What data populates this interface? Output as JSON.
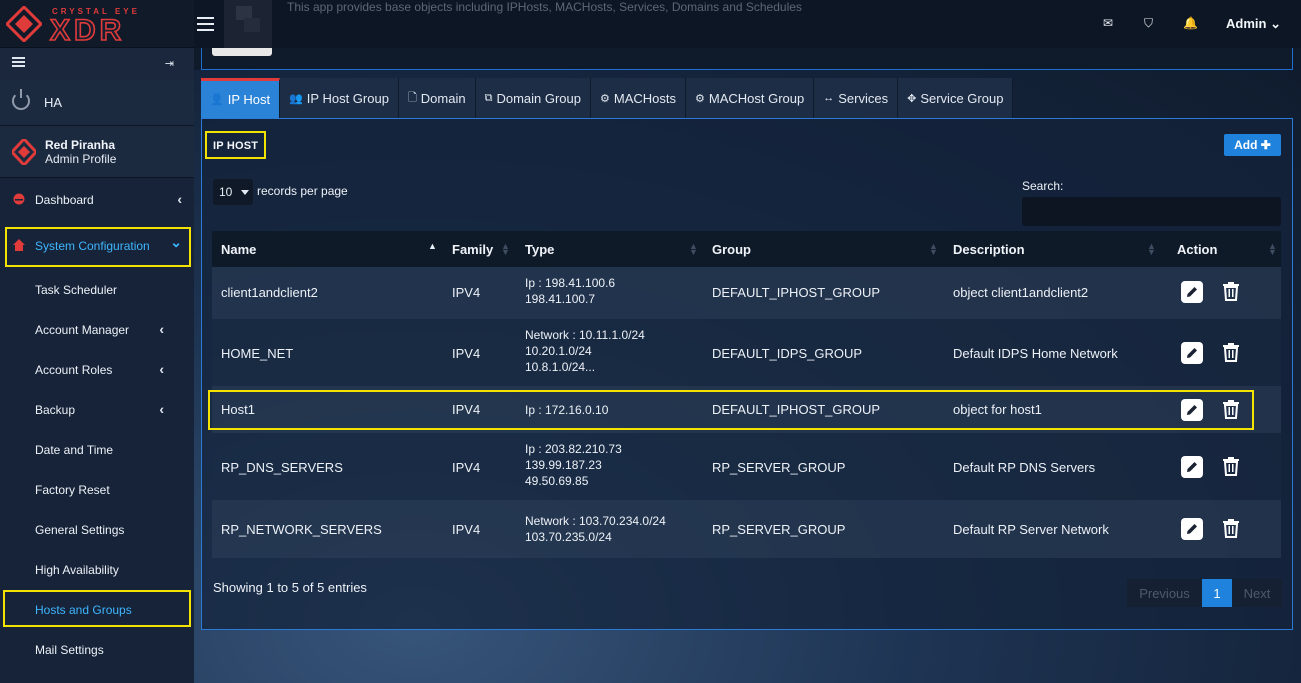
{
  "logo": {
    "top_text": "CRYSTAL EYE",
    "main_text": "XDR"
  },
  "topbar": {
    "app_description": "This app provides base objects including IPHosts, MACHosts, Services, Domains and Schedules",
    "icons": [
      "envelope-icon",
      "shield-icon",
      "bell-icon"
    ],
    "admin_label": "Admin"
  },
  "sidebar": {
    "ha_label": "HA",
    "profile_name": "Red Piranha",
    "profile_sub": "Admin Profile",
    "items": [
      {
        "label": "Dashboard"
      },
      {
        "label": "System Configuration"
      },
      {
        "label": "Task Scheduler"
      },
      {
        "label": "Account Manager"
      },
      {
        "label": "Account Roles"
      },
      {
        "label": "Backup"
      },
      {
        "label": "Date and Time"
      },
      {
        "label": "Factory Reset"
      },
      {
        "label": "General Settings"
      },
      {
        "label": "High Availability"
      },
      {
        "label": "Hosts and Groups"
      },
      {
        "label": "Mail Settings"
      }
    ]
  },
  "tabs": [
    {
      "label": "IP Host",
      "icon": "user-icon",
      "active": true
    },
    {
      "label": "IP Host Group",
      "icon": "users-icon"
    },
    {
      "label": "Domain",
      "icon": "file-icon"
    },
    {
      "label": "Domain Group",
      "icon": "files-icon"
    },
    {
      "label": "MACHosts",
      "icon": "gear-icon"
    },
    {
      "label": "MACHost Group",
      "icon": "gears-icon"
    },
    {
      "label": "Services",
      "icon": "arrows-horizontal-icon"
    },
    {
      "label": "Service Group",
      "icon": "arrows-cross-icon"
    }
  ],
  "panel": {
    "title": "IP HOST",
    "add_label": "Add",
    "page_length": "10",
    "length_label": "records per page",
    "search_label": "Search:",
    "search_value": "",
    "columns": [
      "Name",
      "Family",
      "Type",
      "Group",
      "Description",
      "Action"
    ],
    "rows": [
      {
        "name": "client1andclient2",
        "family": "IPV4",
        "type": [
          "Ip : 198.41.100.6",
          "198.41.100.7"
        ],
        "group": "DEFAULT_IPHOST_GROUP",
        "description": "object client1andclient2"
      },
      {
        "name": "HOME_NET",
        "family": "IPV4",
        "type": [
          "Network : 10.11.1.0/24",
          "10.20.1.0/24",
          "10.8.1.0/24..."
        ],
        "group": "DEFAULT_IDPS_GROUP",
        "description": "Default IDPS Home Network"
      },
      {
        "name": "Host1",
        "family": "IPV4",
        "type": [
          "Ip : 172.16.0.10"
        ],
        "group": "DEFAULT_IPHOST_GROUP",
        "description": "object for host1"
      },
      {
        "name": "RP_DNS_SERVERS",
        "family": "IPV4",
        "type": [
          "Ip : 203.82.210.73",
          "139.99.187.23",
          "49.50.69.85"
        ],
        "group": "RP_SERVER_GROUP",
        "description": "Default RP DNS Servers"
      },
      {
        "name": "RP_NETWORK_SERVERS",
        "family": "IPV4",
        "type": [
          "Network : 103.70.234.0/24",
          "103.70.235.0/24"
        ],
        "group": "RP_SERVER_GROUP",
        "description": "Default RP Server Network"
      }
    ],
    "info": "Showing 1 to 5 of 5 entries",
    "pager": {
      "previous": "Previous",
      "current": "1",
      "next": "Next"
    }
  },
  "colors": {
    "accent": "#1f82dc",
    "brand_red": "#e03b3b",
    "highlight": "#f2e300"
  }
}
